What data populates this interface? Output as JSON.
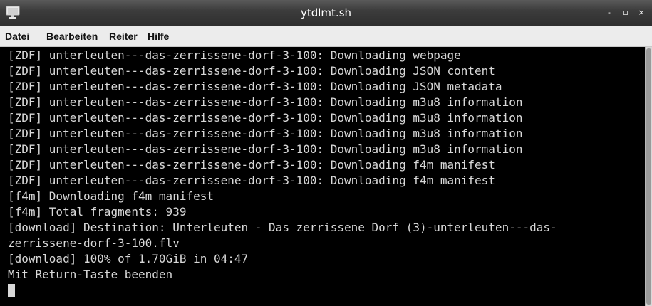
{
  "window": {
    "title": "ytdlmt.sh",
    "controls": {
      "minimize": "-",
      "maximize": "▫",
      "close": "×"
    }
  },
  "menubar": {
    "items": [
      "Datei",
      "Bearbeiten",
      "Reiter",
      "Hilfe"
    ]
  },
  "terminal": {
    "lines": [
      "[ZDF] unterleuten---das-zerrissene-dorf-3-100: Downloading webpage",
      "[ZDF] unterleuten---das-zerrissene-dorf-3-100: Downloading JSON content",
      "[ZDF] unterleuten---das-zerrissene-dorf-3-100: Downloading JSON metadata",
      "[ZDF] unterleuten---das-zerrissene-dorf-3-100: Downloading m3u8 information",
      "[ZDF] unterleuten---das-zerrissene-dorf-3-100: Downloading m3u8 information",
      "[ZDF] unterleuten---das-zerrissene-dorf-3-100: Downloading m3u8 information",
      "[ZDF] unterleuten---das-zerrissene-dorf-3-100: Downloading m3u8 information",
      "[ZDF] unterleuten---das-zerrissene-dorf-3-100: Downloading f4m manifest",
      "[ZDF] unterleuten---das-zerrissene-dorf-3-100: Downloading f4m manifest",
      "[f4m] Downloading f4m manifest",
      "[f4m] Total fragments: 939",
      "[download] Destination: Unterleuten - Das zerrissene Dorf (3)-unterleuten---das-",
      "zerrissene-dorf-3-100.flv",
      "[download] 100% of 1.70GiB in 04:47",
      "Mit Return-Taste beenden"
    ]
  },
  "colors": {
    "terminal_background": "#000000",
    "terminal_foreground": "#d8d8d8",
    "titlebar": "#3c3c3c",
    "menubar": "#ececec"
  },
  "icons": {
    "app": "monitor-icon"
  }
}
